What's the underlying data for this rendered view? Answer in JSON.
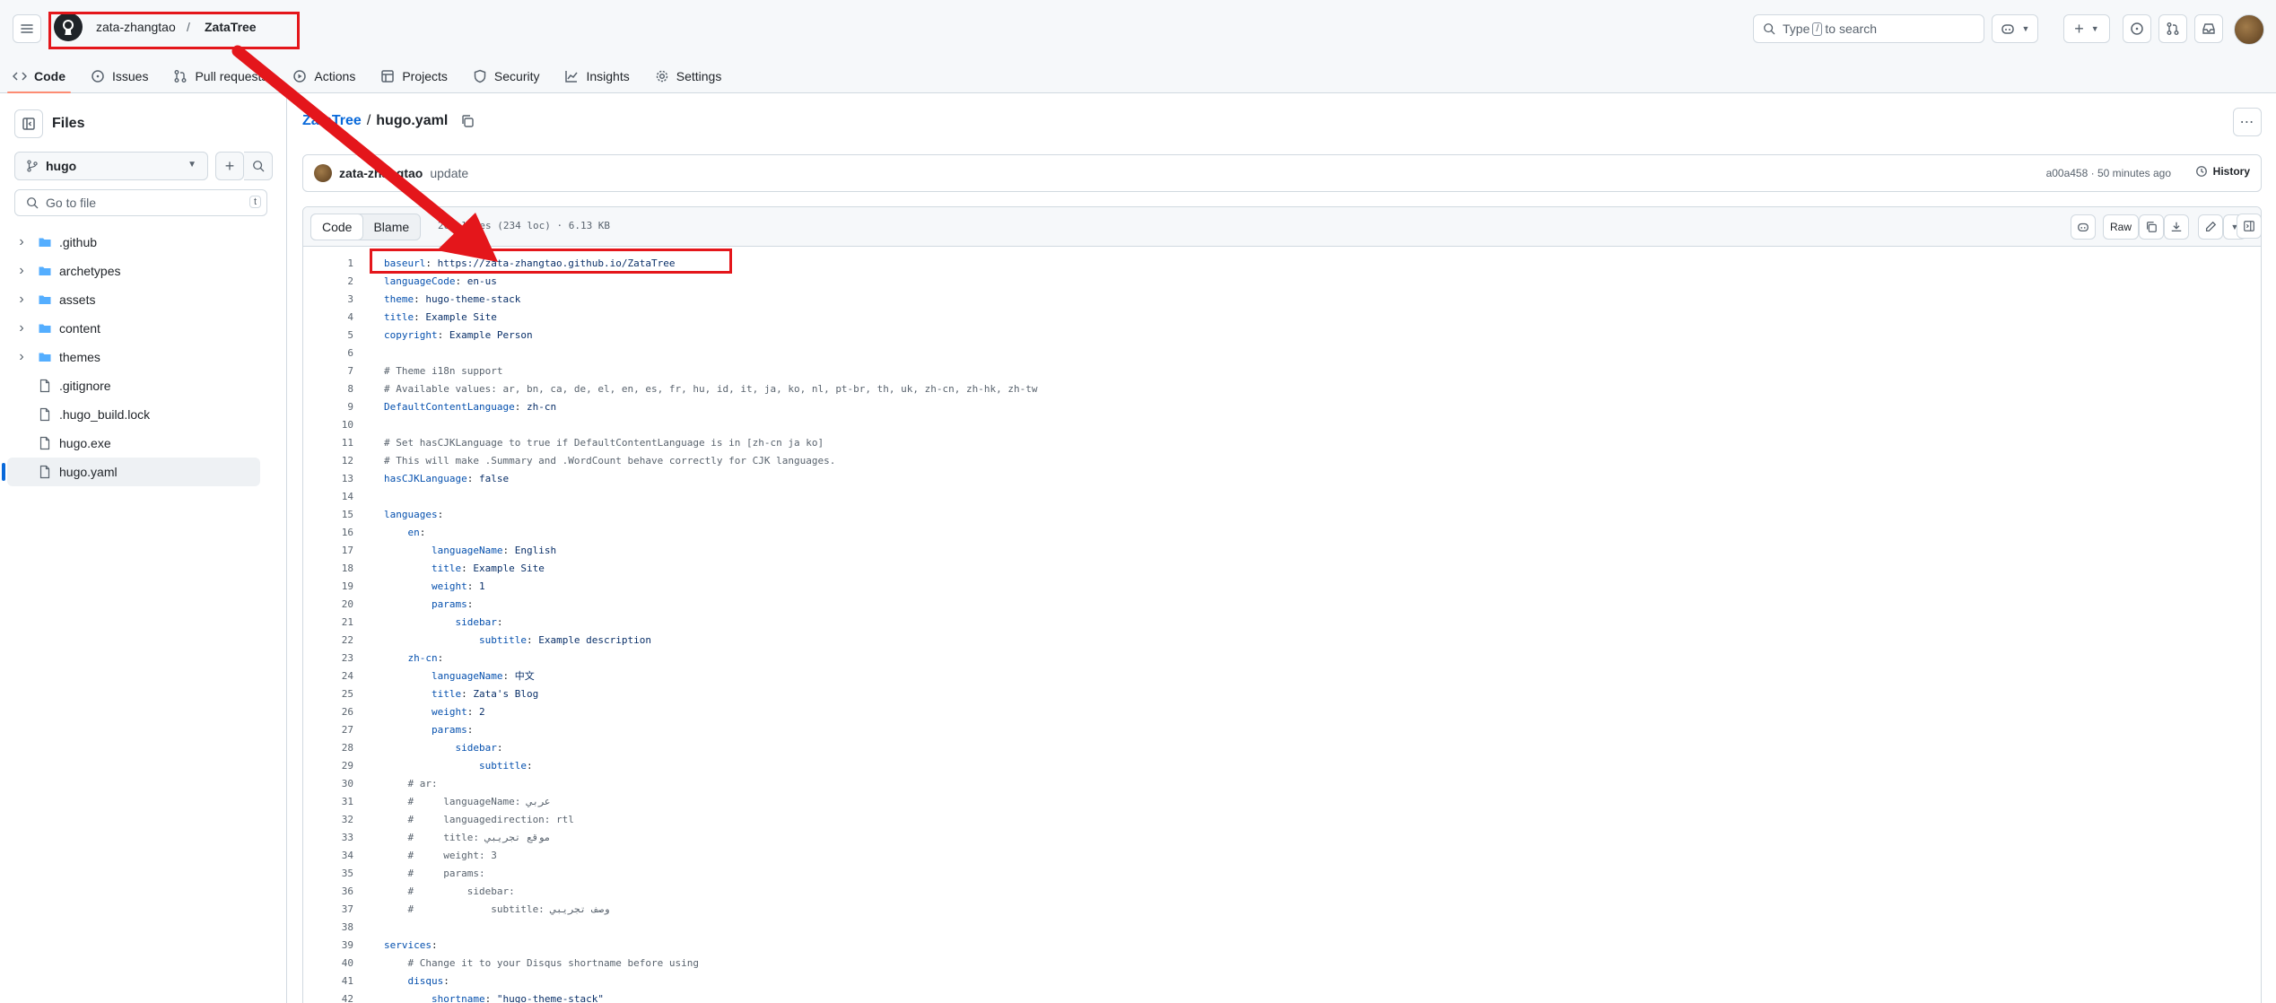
{
  "header": {
    "owner": "zata-zhangtao",
    "separator": "/",
    "repo": "ZataTree",
    "search_prefix": "Type",
    "search_key": "/",
    "search_suffix": "to search"
  },
  "nav": {
    "tabs": [
      {
        "label": "Code",
        "icon": "code-icon"
      },
      {
        "label": "Issues",
        "icon": "issue-icon"
      },
      {
        "label": "Pull requests",
        "icon": "pull-request-icon"
      },
      {
        "label": "Actions",
        "icon": "play-icon"
      },
      {
        "label": "Projects",
        "icon": "table-icon"
      },
      {
        "label": "Security",
        "icon": "shield-icon"
      },
      {
        "label": "Insights",
        "icon": "graph-icon"
      },
      {
        "label": "Settings",
        "icon": "gear-icon"
      }
    ]
  },
  "sidebar": {
    "title": "Files",
    "branch": "hugo",
    "goto_placeholder": "Go to file",
    "goto_key": "t",
    "items": [
      {
        "name": ".github",
        "type": "folder"
      },
      {
        "name": "archetypes",
        "type": "folder"
      },
      {
        "name": "assets",
        "type": "folder"
      },
      {
        "name": "content",
        "type": "folder"
      },
      {
        "name": "themes",
        "type": "folder"
      },
      {
        "name": ".gitignore",
        "type": "file"
      },
      {
        "name": ".hugo_build.lock",
        "type": "file"
      },
      {
        "name": "hugo.exe",
        "type": "file"
      },
      {
        "name": "hugo.yaml",
        "type": "file",
        "selected": true
      }
    ]
  },
  "file": {
    "repo_crumb": "ZataTree",
    "sep": "/",
    "name": "hugo.yaml",
    "commit_author": "zata-zhangtao",
    "commit_message": "update",
    "commit_meta": "a00a458 · 50 minutes ago",
    "history_label": "History",
    "view_code": "Code",
    "view_blame": "Blame",
    "info": "264 lines (234 loc) · 6.13 KB",
    "raw_label": "Raw"
  },
  "code_lines": [
    "baseurl: https://zata-zhangtao.github.io/ZataTree",
    "languageCode: en-us",
    "theme: hugo-theme-stack",
    "title: Example Site",
    "copyright: Example Person",
    "",
    "# Theme i18n support",
    "# Available values: ar, bn, ca, de, el, en, es, fr, hu, id, it, ja, ko, nl, pt-br, th, uk, zh-cn, zh-hk, zh-tw",
    "DefaultContentLanguage: zh-cn",
    "",
    "# Set hasCJKLanguage to true if DefaultContentLanguage is in [zh-cn ja ko]",
    "# This will make .Summary and .WordCount behave correctly for CJK languages.",
    "hasCJKLanguage: false",
    "",
    "languages:",
    "    en:",
    "        languageName: English",
    "        title: Example Site",
    "        weight: 1",
    "        params:",
    "            sidebar:",
    "                subtitle: Example description",
    "    zh-cn:",
    "        languageName: 中文",
    "        title: Zata's Blog",
    "        weight: 2",
    "        params:",
    "            sidebar:",
    "                subtitle:",
    "    # ar:",
    "    #     languageName: عربي",
    "    #     languagedirection: rtl",
    "    #     title: موقع تجريبي",
    "    #     weight: 3",
    "    #     params:",
    "    #         sidebar:",
    "    #             subtitle: وصف تجريبي",
    "",
    "services:",
    "    # Change it to your Disqus shortname before using",
    "    disqus:",
    "        shortname: \"hugo-theme-stack\""
  ],
  "annotation_color": "#e4161b"
}
